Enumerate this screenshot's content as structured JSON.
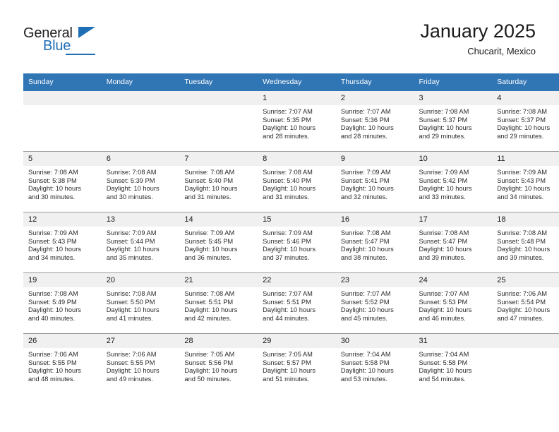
{
  "brand": {
    "name_part1": "General",
    "name_part2": "Blue",
    "triangle_color": "#1f6fb7"
  },
  "header": {
    "title": "January 2025",
    "subtitle": "Chucarit, Mexico"
  },
  "theme": {
    "header_row_bg": "#3075b4",
    "daynum_bg": "#f0f0f0",
    "grid_line": "#9c9c9c",
    "text": "#1a1a1a"
  },
  "weekday_headers": [
    "Sunday",
    "Monday",
    "Tuesday",
    "Wednesday",
    "Thursday",
    "Friday",
    "Saturday"
  ],
  "labels": {
    "sunrise_prefix": "Sunrise:",
    "sunset_prefix": "Sunset:",
    "daylight_prefix": "Daylight:"
  },
  "weeks": [
    [
      {
        "day": "",
        "blank": true,
        "sunrise": "",
        "sunset": "",
        "daylight_line1": "",
        "daylight_line2": ""
      },
      {
        "day": "",
        "blank": true,
        "sunrise": "",
        "sunset": "",
        "daylight_line1": "",
        "daylight_line2": ""
      },
      {
        "day": "",
        "blank": true,
        "sunrise": "",
        "sunset": "",
        "daylight_line1": "",
        "daylight_line2": ""
      },
      {
        "day": "1",
        "blank": false,
        "sunrise": "Sunrise: 7:07 AM",
        "sunset": "Sunset: 5:35 PM",
        "daylight_line1": "Daylight: 10 hours",
        "daylight_line2": "and 28 minutes."
      },
      {
        "day": "2",
        "blank": false,
        "sunrise": "Sunrise: 7:07 AM",
        "sunset": "Sunset: 5:36 PM",
        "daylight_line1": "Daylight: 10 hours",
        "daylight_line2": "and 28 minutes."
      },
      {
        "day": "3",
        "blank": false,
        "sunrise": "Sunrise: 7:08 AM",
        "sunset": "Sunset: 5:37 PM",
        "daylight_line1": "Daylight: 10 hours",
        "daylight_line2": "and 29 minutes."
      },
      {
        "day": "4",
        "blank": false,
        "sunrise": "Sunrise: 7:08 AM",
        "sunset": "Sunset: 5:37 PM",
        "daylight_line1": "Daylight: 10 hours",
        "daylight_line2": "and 29 minutes."
      }
    ],
    [
      {
        "day": "5",
        "blank": false,
        "sunrise": "Sunrise: 7:08 AM",
        "sunset": "Sunset: 5:38 PM",
        "daylight_line1": "Daylight: 10 hours",
        "daylight_line2": "and 30 minutes."
      },
      {
        "day": "6",
        "blank": false,
        "sunrise": "Sunrise: 7:08 AM",
        "sunset": "Sunset: 5:39 PM",
        "daylight_line1": "Daylight: 10 hours",
        "daylight_line2": "and 30 minutes."
      },
      {
        "day": "7",
        "blank": false,
        "sunrise": "Sunrise: 7:08 AM",
        "sunset": "Sunset: 5:40 PM",
        "daylight_line1": "Daylight: 10 hours",
        "daylight_line2": "and 31 minutes."
      },
      {
        "day": "8",
        "blank": false,
        "sunrise": "Sunrise: 7:08 AM",
        "sunset": "Sunset: 5:40 PM",
        "daylight_line1": "Daylight: 10 hours",
        "daylight_line2": "and 31 minutes."
      },
      {
        "day": "9",
        "blank": false,
        "sunrise": "Sunrise: 7:09 AM",
        "sunset": "Sunset: 5:41 PM",
        "daylight_line1": "Daylight: 10 hours",
        "daylight_line2": "and 32 minutes."
      },
      {
        "day": "10",
        "blank": false,
        "sunrise": "Sunrise: 7:09 AM",
        "sunset": "Sunset: 5:42 PM",
        "daylight_line1": "Daylight: 10 hours",
        "daylight_line2": "and 33 minutes."
      },
      {
        "day": "11",
        "blank": false,
        "sunrise": "Sunrise: 7:09 AM",
        "sunset": "Sunset: 5:43 PM",
        "daylight_line1": "Daylight: 10 hours",
        "daylight_line2": "and 34 minutes."
      }
    ],
    [
      {
        "day": "12",
        "blank": false,
        "sunrise": "Sunrise: 7:09 AM",
        "sunset": "Sunset: 5:43 PM",
        "daylight_line1": "Daylight: 10 hours",
        "daylight_line2": "and 34 minutes."
      },
      {
        "day": "13",
        "blank": false,
        "sunrise": "Sunrise: 7:09 AM",
        "sunset": "Sunset: 5:44 PM",
        "daylight_line1": "Daylight: 10 hours",
        "daylight_line2": "and 35 minutes."
      },
      {
        "day": "14",
        "blank": false,
        "sunrise": "Sunrise: 7:09 AM",
        "sunset": "Sunset: 5:45 PM",
        "daylight_line1": "Daylight: 10 hours",
        "daylight_line2": "and 36 minutes."
      },
      {
        "day": "15",
        "blank": false,
        "sunrise": "Sunrise: 7:09 AM",
        "sunset": "Sunset: 5:46 PM",
        "daylight_line1": "Daylight: 10 hours",
        "daylight_line2": "and 37 minutes."
      },
      {
        "day": "16",
        "blank": false,
        "sunrise": "Sunrise: 7:08 AM",
        "sunset": "Sunset: 5:47 PM",
        "daylight_line1": "Daylight: 10 hours",
        "daylight_line2": "and 38 minutes."
      },
      {
        "day": "17",
        "blank": false,
        "sunrise": "Sunrise: 7:08 AM",
        "sunset": "Sunset: 5:47 PM",
        "daylight_line1": "Daylight: 10 hours",
        "daylight_line2": "and 39 minutes."
      },
      {
        "day": "18",
        "blank": false,
        "sunrise": "Sunrise: 7:08 AM",
        "sunset": "Sunset: 5:48 PM",
        "daylight_line1": "Daylight: 10 hours",
        "daylight_line2": "and 39 minutes."
      }
    ],
    [
      {
        "day": "19",
        "blank": false,
        "sunrise": "Sunrise: 7:08 AM",
        "sunset": "Sunset: 5:49 PM",
        "daylight_line1": "Daylight: 10 hours",
        "daylight_line2": "and 40 minutes."
      },
      {
        "day": "20",
        "blank": false,
        "sunrise": "Sunrise: 7:08 AM",
        "sunset": "Sunset: 5:50 PM",
        "daylight_line1": "Daylight: 10 hours",
        "daylight_line2": "and 41 minutes."
      },
      {
        "day": "21",
        "blank": false,
        "sunrise": "Sunrise: 7:08 AM",
        "sunset": "Sunset: 5:51 PM",
        "daylight_line1": "Daylight: 10 hours",
        "daylight_line2": "and 42 minutes."
      },
      {
        "day": "22",
        "blank": false,
        "sunrise": "Sunrise: 7:07 AM",
        "sunset": "Sunset: 5:51 PM",
        "daylight_line1": "Daylight: 10 hours",
        "daylight_line2": "and 44 minutes."
      },
      {
        "day": "23",
        "blank": false,
        "sunrise": "Sunrise: 7:07 AM",
        "sunset": "Sunset: 5:52 PM",
        "daylight_line1": "Daylight: 10 hours",
        "daylight_line2": "and 45 minutes."
      },
      {
        "day": "24",
        "blank": false,
        "sunrise": "Sunrise: 7:07 AM",
        "sunset": "Sunset: 5:53 PM",
        "daylight_line1": "Daylight: 10 hours",
        "daylight_line2": "and 46 minutes."
      },
      {
        "day": "25",
        "blank": false,
        "sunrise": "Sunrise: 7:06 AM",
        "sunset": "Sunset: 5:54 PM",
        "daylight_line1": "Daylight: 10 hours",
        "daylight_line2": "and 47 minutes."
      }
    ],
    [
      {
        "day": "26",
        "blank": false,
        "sunrise": "Sunrise: 7:06 AM",
        "sunset": "Sunset: 5:55 PM",
        "daylight_line1": "Daylight: 10 hours",
        "daylight_line2": "and 48 minutes."
      },
      {
        "day": "27",
        "blank": false,
        "sunrise": "Sunrise: 7:06 AM",
        "sunset": "Sunset: 5:55 PM",
        "daylight_line1": "Daylight: 10 hours",
        "daylight_line2": "and 49 minutes."
      },
      {
        "day": "28",
        "blank": false,
        "sunrise": "Sunrise: 7:05 AM",
        "sunset": "Sunset: 5:56 PM",
        "daylight_line1": "Daylight: 10 hours",
        "daylight_line2": "and 50 minutes."
      },
      {
        "day": "29",
        "blank": false,
        "sunrise": "Sunrise: 7:05 AM",
        "sunset": "Sunset: 5:57 PM",
        "daylight_line1": "Daylight: 10 hours",
        "daylight_line2": "and 51 minutes."
      },
      {
        "day": "30",
        "blank": false,
        "sunrise": "Sunrise: 7:04 AM",
        "sunset": "Sunset: 5:58 PM",
        "daylight_line1": "Daylight: 10 hours",
        "daylight_line2": "and 53 minutes."
      },
      {
        "day": "31",
        "blank": false,
        "sunrise": "Sunrise: 7:04 AM",
        "sunset": "Sunset: 5:58 PM",
        "daylight_line1": "Daylight: 10 hours",
        "daylight_line2": "and 54 minutes."
      },
      {
        "day": "",
        "blank": true,
        "sunrise": "",
        "sunset": "",
        "daylight_line1": "",
        "daylight_line2": ""
      }
    ]
  ]
}
